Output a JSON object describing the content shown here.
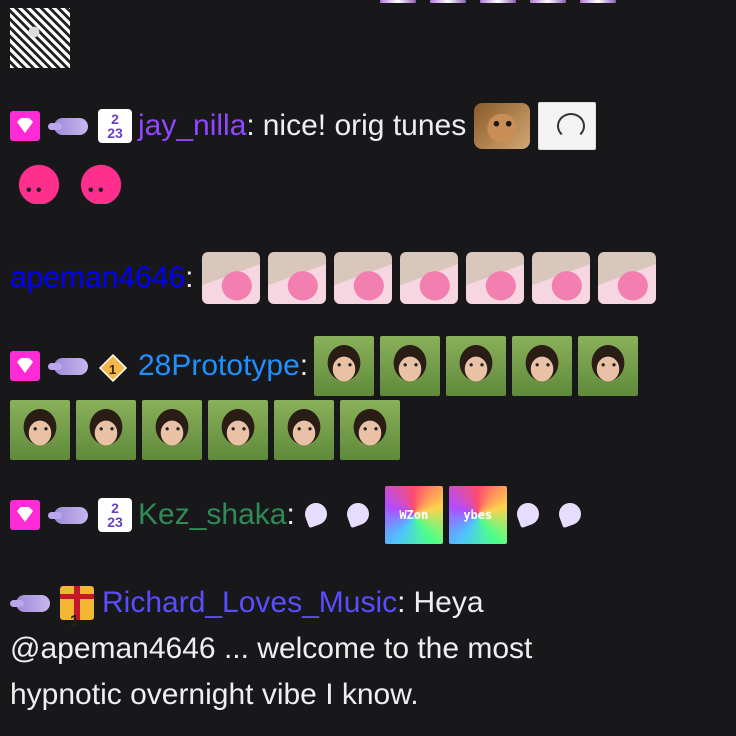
{
  "colors": {
    "background": "#18181b",
    "text": "#efeff1",
    "user_jay": "#9147ff",
    "user_ape": "#0000ff",
    "user_proto": "#1e90ff",
    "user_kez": "#2e8b57",
    "user_richard": "#5a4dff",
    "sub_badge": "#ff2bd6"
  },
  "badges": {
    "year_2023": "2\n23",
    "gift_count": "1"
  },
  "messages": [
    {
      "user": "jay_nilla",
      "text": "nice! orig tunes"
    },
    {
      "user": "apeman4646",
      "text": ""
    },
    {
      "user": "28Prototype",
      "text": ""
    },
    {
      "user": "Kez_shaka",
      "text": ""
    },
    {
      "user": "Richard_Loves_Music",
      "text": "Heya",
      "text2": "@apeman4646 ... welcome to the most",
      "text3": "hypnotic overnight vibe I know."
    }
  ],
  "colon": ":",
  "emote_labels": {
    "rainbow_a": "WZon",
    "rainbow_b": "ybes"
  }
}
